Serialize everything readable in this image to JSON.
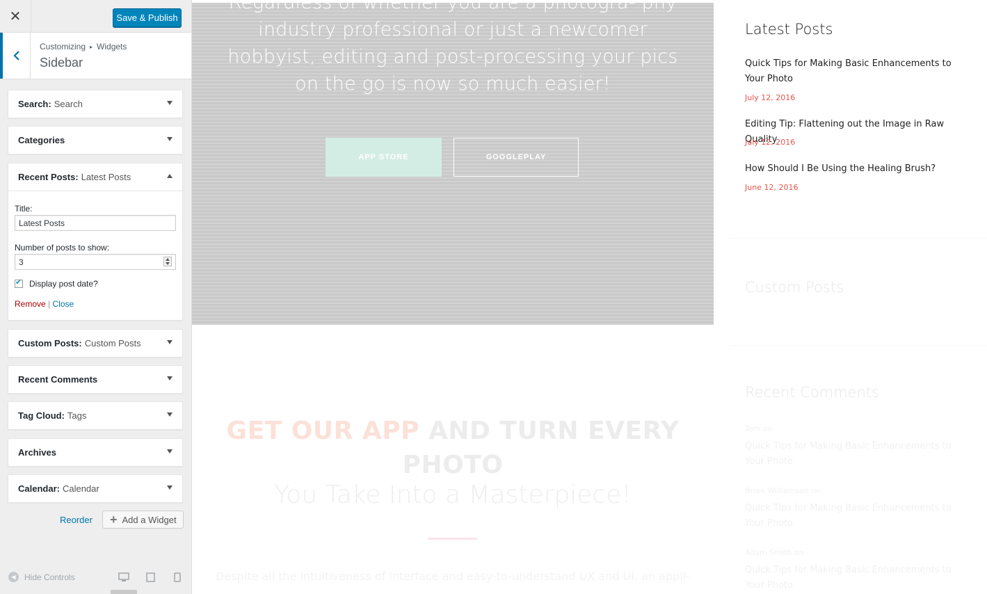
{
  "customizer": {
    "close_symbol": "✕",
    "save_label": "Save & Publish",
    "breadcrumb_root": "Customizing",
    "breadcrumb_sep": "▸",
    "breadcrumb_current": "Widgets",
    "section_title": "Sidebar",
    "widgets": [
      {
        "name": "Search:",
        "sub": "Search"
      },
      {
        "name": "Categories",
        "sub": ""
      },
      {
        "name": "Recent Posts:",
        "sub": "Latest Posts",
        "expanded": true
      },
      {
        "name": "Custom Posts:",
        "sub": "Custom Posts"
      },
      {
        "name": "Recent Comments",
        "sub": ""
      },
      {
        "name": "Tag Cloud:",
        "sub": "Tags"
      },
      {
        "name": "Archives",
        "sub": ""
      },
      {
        "name": "Calendar:",
        "sub": "Calendar"
      }
    ],
    "recent_posts_form": {
      "title_label": "Title:",
      "title_value": "Latest Posts",
      "count_label": "Number of posts to show:",
      "count_value": "3",
      "show_date_label": "Display post date?",
      "show_date_checked": true,
      "remove_label": "Remove",
      "separator": "|",
      "close_label": "Close"
    },
    "reorder_label": "Reorder",
    "add_widget_label": "Add a Widget",
    "hide_controls_label": "Hide Controls",
    "accent_color": "#0073aa",
    "primary_button_color": "#0085ba"
  },
  "preview": {
    "hero_text": "Regardless of whether you are a photogra- phy industry professional or just a newcomer hobbyist, editing and post-processing your pics on the go is now so much easier!",
    "app_store_label": "APP STORE",
    "googleplay_label": "GOOGLEPLAY",
    "app_heading_accent": "GET OUR APP",
    "app_heading_rest": "AND TURN EVERY PHOTO",
    "app_subheading": "You Take Into a Masterpiece!",
    "app_description": "Despite all the intuitiveness of interface and easy-to-understand UX and UI, an appli-",
    "sidebar": {
      "latest_title": "Latest Posts",
      "latest_posts": [
        {
          "title": "Quick Tips for Making Basic Enhancements to Your Photo",
          "date": "July 12, 2016"
        },
        {
          "title": "Editing Tip: Flattening out the Image in Raw Quality",
          "date": "July 12, 2016"
        },
        {
          "title": "How Should I Be Using the Healing Brush?",
          "date": "June 12, 2016"
        }
      ],
      "custom_title": "Custom Posts",
      "comments_title": "Recent Comments",
      "comments": [
        {
          "author": "Tom",
          "on": "on",
          "post": "Quick Tips for Making Basic Enhancements to Your Photo"
        },
        {
          "author": "Brian Williamson",
          "on": "on",
          "post": "Quick Tips for Making Basic Enhancements to Your Photo"
        },
        {
          "author": "Adam Smith",
          "on": "on",
          "post": "Quick Tips for Making Basic Enhancements to Your Photo"
        }
      ],
      "date_color": "#e5534b"
    }
  }
}
